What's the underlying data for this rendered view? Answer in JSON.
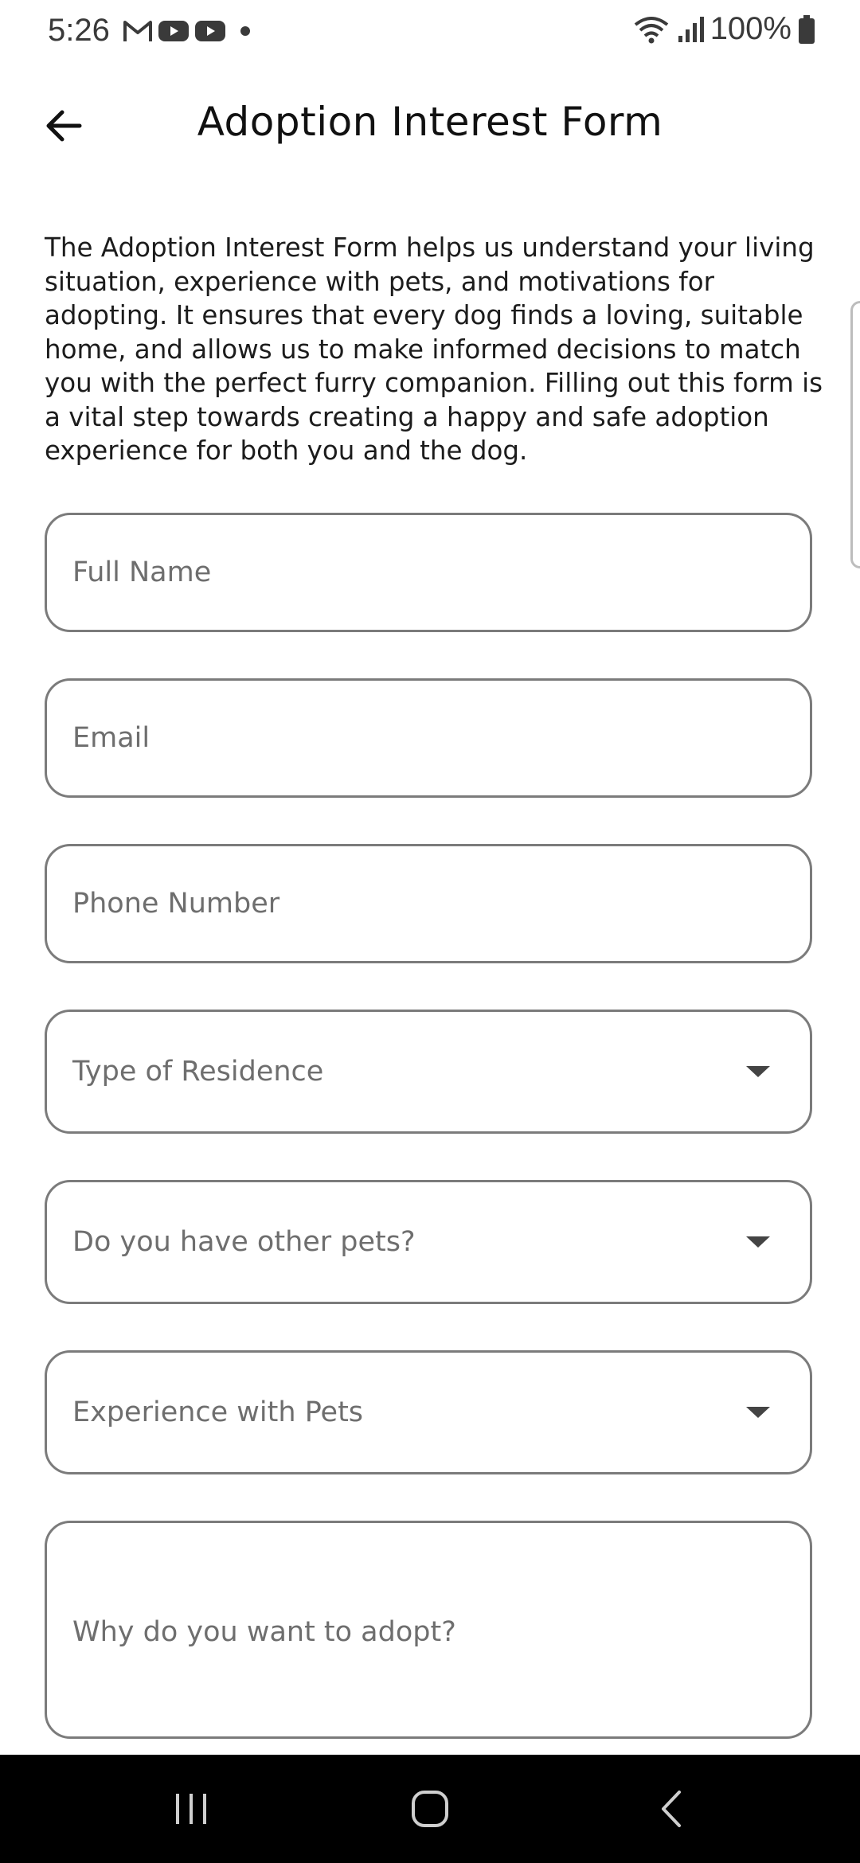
{
  "status_bar": {
    "time": "5:26",
    "battery": "100%",
    "icons": [
      "gmail-icon",
      "youtube-icon",
      "youtube-icon",
      "dot-icon",
      "wifi-icon",
      "signal-icon",
      "battery-icon"
    ]
  },
  "header": {
    "title": "Adoption Interest Form",
    "back_icon": "arrow-left-icon"
  },
  "intro": "The Adoption Interest Form helps us understand your living situation, experience with pets, and motivations for adopting. It ensures that every dog finds a loving, suitable home, and allows us to make informed decisions to match you with the perfect furry companion. Filling out this form is a vital step towards creating a happy and safe adoption experience for both you and the dog.",
  "form": {
    "full_name": {
      "placeholder": "Full Name",
      "value": ""
    },
    "email": {
      "placeholder": "Email",
      "value": ""
    },
    "phone": {
      "placeholder": "Phone Number",
      "value": ""
    },
    "residence": {
      "label": "Type of Residence"
    },
    "other_pets": {
      "label": "Do you have other pets?"
    },
    "experience": {
      "label": "Experience with Pets"
    },
    "why_adopt": {
      "placeholder": "Why do you want to adopt?",
      "value": ""
    }
  },
  "nav": {
    "recents_icon": "recents-icon",
    "home_icon": "home-icon",
    "back_icon": "back-chevron-icon"
  },
  "colors": {
    "border": "#7b7b7b",
    "placeholder": "#6e6e6e",
    "nav_background": "#000000"
  }
}
